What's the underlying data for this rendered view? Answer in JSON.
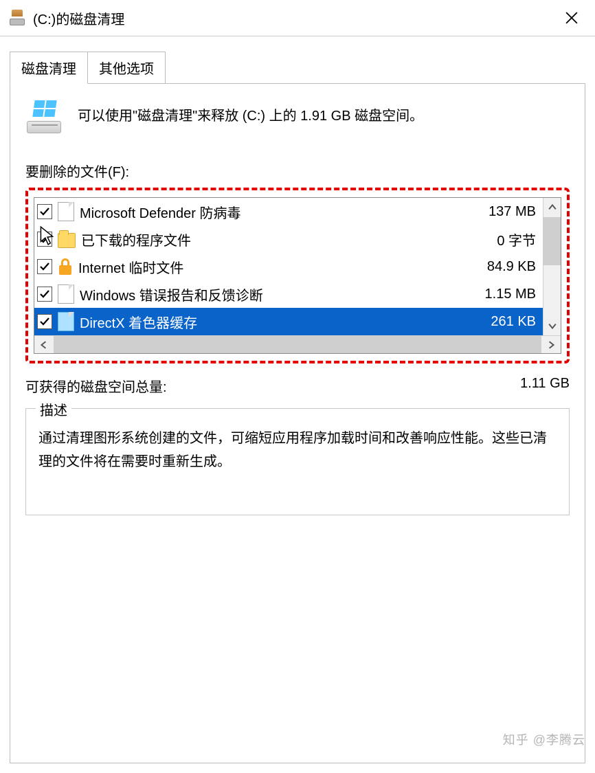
{
  "window": {
    "title": "(C:)的磁盘清理",
    "close_label": "关闭"
  },
  "tabs": {
    "cleanup": "磁盘清理",
    "other": "其他选项"
  },
  "intro": "可以使用\"磁盘清理\"来释放  (C:) 上的 1.91 GB 磁盘空间。",
  "files": {
    "label": "要删除的文件(F):",
    "items": [
      {
        "name": "Microsoft Defender 防病毒",
        "size": "137 MB",
        "checked": true,
        "icon": "page",
        "selected": false
      },
      {
        "name": "已下载的程序文件",
        "size": "0 字节",
        "checked": true,
        "icon": "folder",
        "selected": false
      },
      {
        "name": "Internet 临时文件",
        "size": "84.9 KB",
        "checked": true,
        "icon": "lock",
        "selected": false
      },
      {
        "name": "Windows 错误报告和反馈诊断",
        "size": "1.15 MB",
        "checked": true,
        "icon": "page",
        "selected": false
      },
      {
        "name": "DirectX 着色器缓存",
        "size": "261 KB",
        "checked": true,
        "icon": "page-blue",
        "selected": true
      }
    ]
  },
  "total": {
    "label": "可获得的磁盘空间总量:",
    "value": "1.11 GB"
  },
  "description": {
    "legend": "描述",
    "text": "通过清理图形系统创建的文件，可缩短应用程序加载时间和改善响应性能。这些已清理的文件将在需要时重新生成。"
  },
  "watermark": "知乎 @李腾云"
}
